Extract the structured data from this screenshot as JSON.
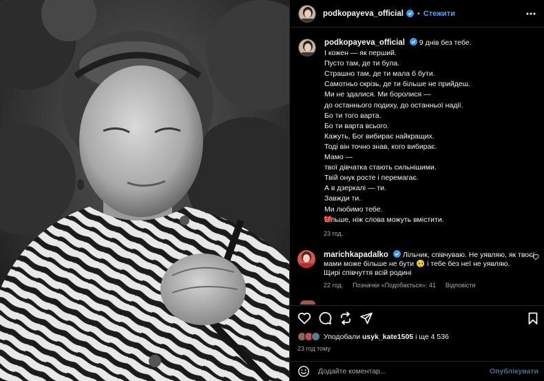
{
  "post": {
    "author": "podkopayeva_official",
    "follow_label": "Стежити",
    "dot": "•",
    "caption_lines": [
      "9 днів без тебе.",
      "І кожен — як перший.",
      "Пусто там, де ти була.",
      "Страшно там, де ти мала б бути.",
      "Самотньо скрізь, де ти більше не прийдеш.",
      "Ми не здалися. Ми боролися —",
      "до останнього подиху, до останньої надії.",
      "Бо ти того варта.",
      "Бо ти варта всього.",
      "Кажуть, Бог вибирає найкращих.",
      "Тоді він точно знав, кого вибирає.",
      "Мамо —",
      "твої дівчатка стають сильнішими.",
      "Твій онук росте і перемагає.",
      "А в дзеркалі — ти.",
      "Завжди ти.",
      "Ми любимо тебе.",
      "Більше, ніж слова можуть вмістити."
    ],
    "caption_emoji": "💔",
    "caption_time": "23 год."
  },
  "comment": {
    "author": "marichkapadalko",
    "text_line1": "Лільчик, співчуваю. Не уявляю, як твоєї",
    "text_line2": "мами може більше не бути 🥺 і тебе без неї не уявляю.",
    "text_line3": "Щирі співчуття всій родині",
    "time": "22 год.",
    "likes": "Позначки «Подобається»: 41",
    "reply": "Відповісти"
  },
  "likes": {
    "prefix": "Уподобали",
    "user": "usyk_kate1505",
    "suffix": "і ще 4 536"
  },
  "posted_ago": "23 год тому",
  "comment_bar": {
    "placeholder": "Додайте коментар...",
    "publish": "Опублікувати"
  },
  "icons": [
    "more-icon",
    "heart-icon",
    "comment-icon",
    "share-icon",
    "send-icon",
    "bookmark-icon",
    "emoji-icon",
    "verified-icon",
    "small-heart-icon"
  ],
  "colors": {
    "link": "#4aa3ff",
    "verified": "#3897f0",
    "muted": "#a8a8a8",
    "broken_heart": "#e0245e"
  }
}
